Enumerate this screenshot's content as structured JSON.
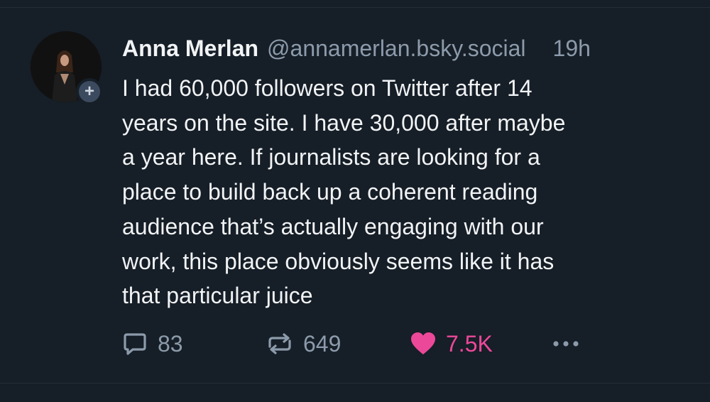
{
  "author": {
    "display_name": "Anna Merlan",
    "handle": "@annamerlan.bsky.social",
    "timestamp": "19h",
    "follow_badge": "+"
  },
  "post": {
    "text": "I had 60,000 followers on Twitter after 14\nyears on the site. I have 30,000 after maybe\na year here. If journalists are looking for a\nplace to build back up a coherent reading\naudience that’s actually engaging with our\nwork, this place obviously seems like it has\nthat particular juice"
  },
  "actions": {
    "reply_count": "83",
    "repost_count": "649",
    "like_count": "7.5K",
    "liked": true
  },
  "icons": {
    "reply": "speech-bubble-icon",
    "repost": "repost-arrows-icon",
    "like": "heart-icon",
    "more": "ellipsis-icon"
  },
  "colors": {
    "background": "#161e27",
    "text": "#f1f3f5",
    "muted": "#8c9bab",
    "like": "#ec4899",
    "badge": "#3b4a5e"
  }
}
